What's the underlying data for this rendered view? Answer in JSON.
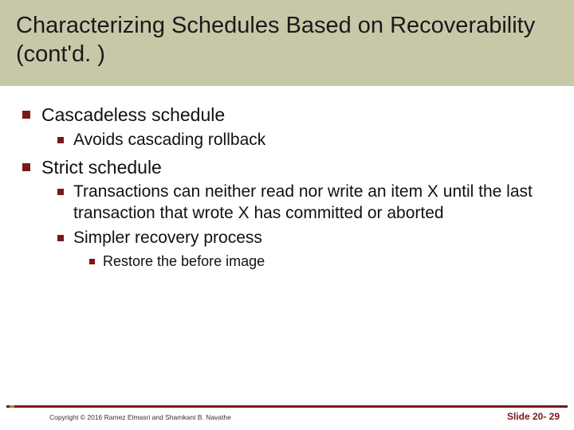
{
  "title": "Characterizing Schedules Based on Recoverability (cont'd. )",
  "bullets": [
    {
      "text": "Cascadeless schedule",
      "children": [
        {
          "text": "Avoids cascading rollback",
          "children": []
        }
      ]
    },
    {
      "text": "Strict schedule",
      "children": [
        {
          "text": "Transactions can neither read nor write an item X until the last transaction that wrote X has committed or aborted",
          "children": []
        },
        {
          "text": "Simpler recovery process",
          "children": [
            {
              "text": "Restore the before image",
              "children": []
            }
          ]
        }
      ]
    }
  ],
  "copyright": "Copyright © 2016 Ramez Elmasri and Shamkant B. Navathe",
  "slide_number": "Slide 20- 29"
}
